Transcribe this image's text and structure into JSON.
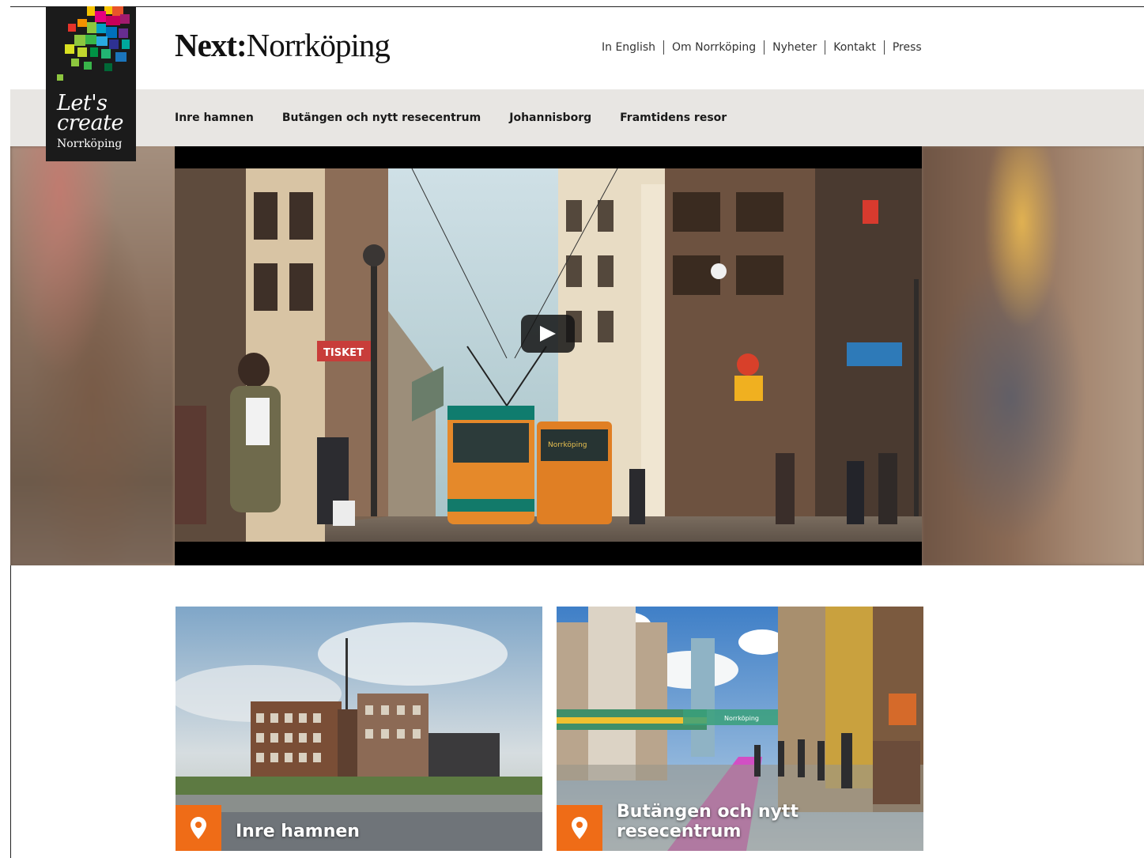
{
  "brand": {
    "bold": "Next:",
    "regular": "Norrköping"
  },
  "logo": {
    "line1": "Let's",
    "line2": "create",
    "line3": "Norrköping"
  },
  "top_links": [
    "In English",
    "Om Norrköping",
    "Nyheter",
    "Kontakt",
    "Press"
  ],
  "nav": [
    "Inre hamnen",
    "Butängen och nytt resecentrum",
    "Johannisborg",
    "Framtidens resor"
  ],
  "video": {
    "storefront_sign": "TISKET",
    "tram_sign": "Norrköping"
  },
  "cards": [
    {
      "title": "Inre hamnen",
      "icon": "map-pin-icon"
    },
    {
      "title": "Butängen och nytt resecentrum",
      "icon": "map-pin-icon",
      "tram_label": "Norrköping"
    }
  ],
  "colors": {
    "nav_bg": "#e8e6e3",
    "accent": "#ef6c17",
    "logo_bg": "#1b1b1b"
  }
}
